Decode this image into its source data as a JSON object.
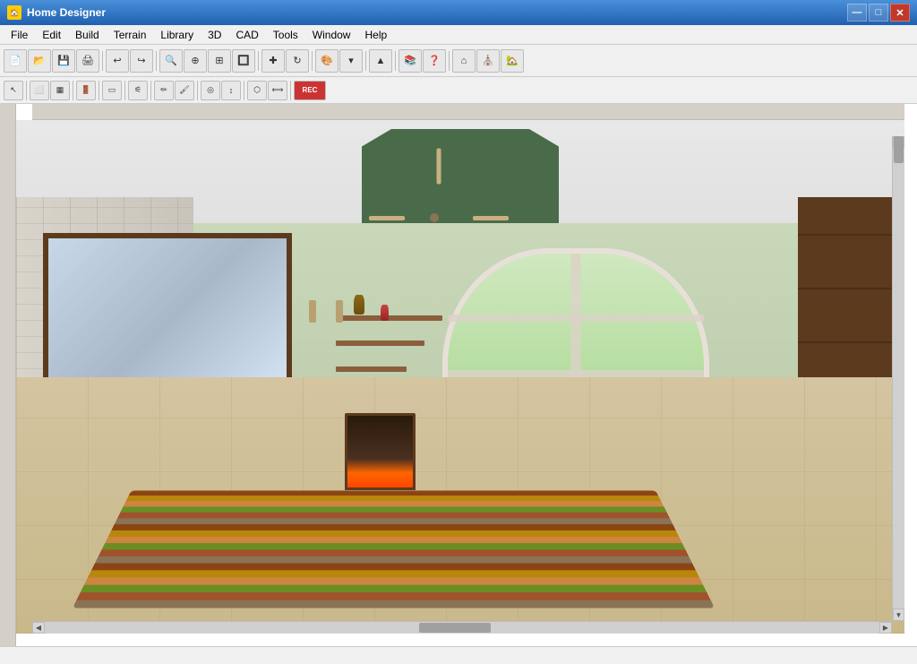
{
  "window": {
    "title": "Home Designer",
    "icon": "🏠"
  },
  "titlebar": {
    "minimize": "—",
    "maximize": "□",
    "close": "✕"
  },
  "menu": {
    "items": [
      {
        "id": "file",
        "label": "File"
      },
      {
        "id": "edit",
        "label": "Edit"
      },
      {
        "id": "build",
        "label": "Build"
      },
      {
        "id": "terrain",
        "label": "Terrain"
      },
      {
        "id": "library",
        "label": "Library"
      },
      {
        "id": "3d",
        "label": "3D"
      },
      {
        "id": "cad",
        "label": "CAD"
      },
      {
        "id": "tools",
        "label": "Tools"
      },
      {
        "id": "window",
        "label": "Window"
      },
      {
        "id": "help",
        "label": "Help"
      }
    ]
  },
  "toolbar1": {
    "buttons": [
      {
        "id": "new",
        "icon": "📄",
        "label": "New"
      },
      {
        "id": "open",
        "icon": "📂",
        "label": "Open"
      },
      {
        "id": "save",
        "icon": "💾",
        "label": "Save"
      },
      {
        "id": "print",
        "icon": "🖨",
        "label": "Print"
      },
      {
        "id": "sep1",
        "type": "sep"
      },
      {
        "id": "undo",
        "icon": "↩",
        "label": "Undo"
      },
      {
        "id": "redo",
        "icon": "↪",
        "label": "Redo"
      },
      {
        "id": "sep2",
        "type": "sep"
      },
      {
        "id": "zoom-in",
        "icon": "🔍",
        "label": "Zoom In"
      },
      {
        "id": "zoom-out",
        "icon": "🔎",
        "label": "Zoom Out"
      },
      {
        "id": "zoom-fit",
        "icon": "⊕",
        "label": "Zoom Fit"
      },
      {
        "id": "zoom-ext",
        "icon": "⊞",
        "label": "Zoom Extents"
      },
      {
        "id": "sep3",
        "type": "sep"
      },
      {
        "id": "pan",
        "icon": "✋",
        "label": "Pan"
      },
      {
        "id": "rotate",
        "icon": "↻",
        "label": "Rotate"
      },
      {
        "id": "sep4",
        "type": "sep"
      },
      {
        "id": "materials",
        "icon": "🎨",
        "label": "Materials"
      },
      {
        "id": "drop",
        "icon": "▼",
        "label": ""
      },
      {
        "id": "sep5",
        "type": "sep"
      },
      {
        "id": "nav",
        "icon": "▲",
        "label": "Navigate"
      },
      {
        "id": "sep6",
        "type": "sep"
      },
      {
        "id": "catalog",
        "icon": "📚",
        "label": "Catalog"
      },
      {
        "id": "help2",
        "icon": "❓",
        "label": "Help"
      },
      {
        "id": "sep7",
        "type": "sep"
      },
      {
        "id": "house1",
        "icon": "🏠",
        "label": "House View"
      },
      {
        "id": "house2",
        "icon": "⛪",
        "label": "Camera"
      },
      {
        "id": "house3",
        "icon": "🏡",
        "label": "3D View"
      }
    ]
  },
  "toolbar2": {
    "buttons": [
      {
        "id": "select",
        "icon": "↖",
        "label": "Select"
      },
      {
        "id": "sep1",
        "type": "sep"
      },
      {
        "id": "draw-wall",
        "icon": "⬜",
        "label": "Draw Wall"
      },
      {
        "id": "sep2",
        "type": "sep"
      },
      {
        "id": "room",
        "icon": "▦",
        "label": "Room"
      },
      {
        "id": "sep3",
        "type": "sep"
      },
      {
        "id": "door",
        "icon": "🚪",
        "label": "Door"
      },
      {
        "id": "sep4",
        "type": "sep"
      },
      {
        "id": "window",
        "icon": "🪟",
        "label": "Window"
      },
      {
        "id": "sep5",
        "type": "sep"
      },
      {
        "id": "stairs",
        "icon": "🪜",
        "label": "Stairs"
      },
      {
        "id": "sep6",
        "type": "sep"
      },
      {
        "id": "pencil",
        "icon": "✏",
        "label": "Pencil"
      },
      {
        "id": "color",
        "icon": "🖌",
        "label": "Color"
      },
      {
        "id": "sep7",
        "type": "sep"
      },
      {
        "id": "obj1",
        "icon": "◎",
        "label": "Object1"
      },
      {
        "id": "obj2",
        "icon": "↕",
        "label": "Object2"
      },
      {
        "id": "sep8",
        "type": "sep"
      },
      {
        "id": "rec",
        "icon": "⏺",
        "label": "Record",
        "special": "REC"
      }
    ]
  },
  "statusbar": {
    "coords": "",
    "info": ""
  },
  "colors": {
    "titlebar_start": "#4a90d9",
    "titlebar_end": "#2060b0",
    "menu_bg": "#f0f0f0",
    "toolbar_bg": "#f0f0f0",
    "canvas_bg": "#888888",
    "status_bg": "#f0f0f0"
  }
}
